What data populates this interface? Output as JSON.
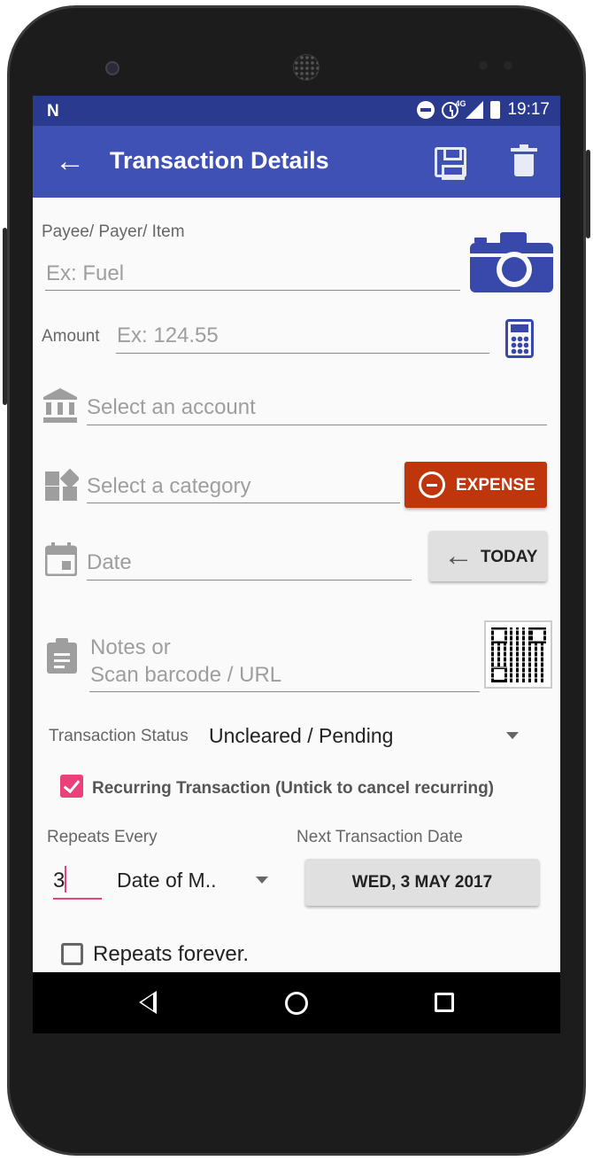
{
  "status_bar": {
    "time": "19:17",
    "network": "4G"
  },
  "app_bar": {
    "title": "Transaction Details"
  },
  "form": {
    "payee_label": "Payee/ Payer/ Item",
    "payee_placeholder": "Ex: Fuel",
    "amount_label": "Amount",
    "amount_placeholder": "Ex: 124.55",
    "account_placeholder": "Select an account",
    "category_placeholder": "Select a category",
    "expense_label": "EXPENSE",
    "date_placeholder": "Date",
    "today_label": "TODAY",
    "notes_placeholder_line1": "Notes or",
    "notes_placeholder_line2": "Scan barcode / URL",
    "status_label": "Transaction Status",
    "status_value": "Uncleared / Pending",
    "recurring_label": "Recurring Transaction (Untick to cancel recurring)",
    "recurring_checked": true,
    "repeats_label": "Repeats Every",
    "repeats_value": "3",
    "repeats_unit": "Date of M..",
    "next_date_label": "Next Transaction Date",
    "next_date_value": "WED, 3 MAY 2017",
    "forever_label": "Repeats forever.",
    "forever_checked": false
  },
  "colors": {
    "app_bar": "#3f51b5",
    "status_bar": "#2a3a8f",
    "expense": "#bf360c",
    "accent": "#ec407a",
    "icon_blue": "#3949ab"
  }
}
